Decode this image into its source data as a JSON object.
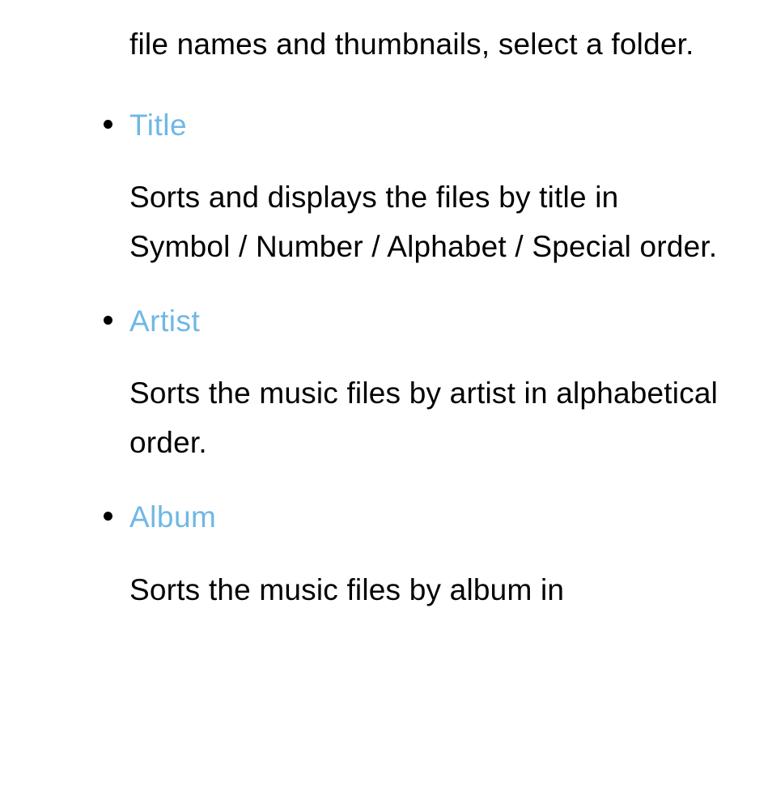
{
  "partial_top_text": "file names and thumbnails, select a folder.",
  "items": [
    {
      "heading": "Title",
      "body": "Sorts and displays the files by title in Symbol / Number / Alphabet / Special order."
    },
    {
      "heading": "Artist",
      "body": "Sorts the music files by artist in alphabetical order."
    },
    {
      "heading": "Album",
      "body": "Sorts the music files by album in"
    }
  ]
}
